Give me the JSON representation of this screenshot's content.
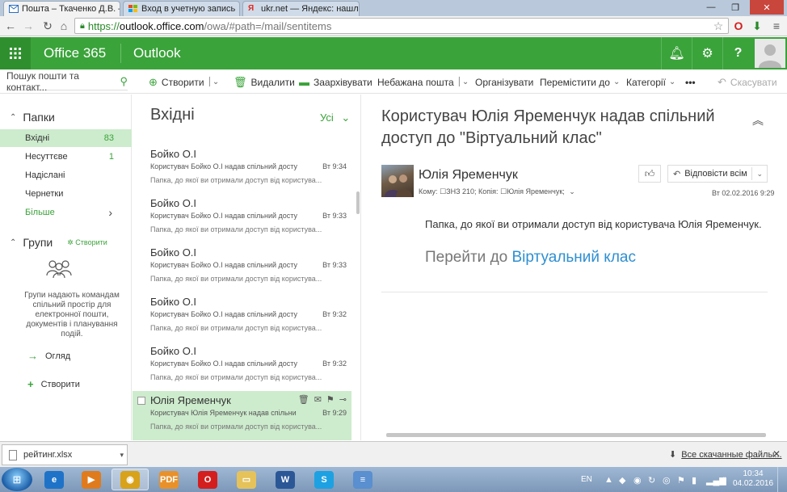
{
  "browser": {
    "tabs": [
      {
        "label": "Пошта – Ткаченко Д.В. – "
      },
      {
        "label": "Вход в учетную запись"
      },
      {
        "label": "ukr.net — Яндекс: нашло"
      }
    ],
    "url_scheme": "https://",
    "url_host": "outlook.office.com",
    "url_path": "/owa/#path=/mail/sentitems"
  },
  "suite": {
    "brand": "Office 365",
    "app": "Outlook",
    "accent": "#3aa33a"
  },
  "commands": {
    "search_placeholder": "Пошук пошти та контакт...",
    "new": "Створити",
    "delete": "Видалити",
    "archive": "Заархівувати",
    "junk": "Небажана пошта",
    "sweep": "Організувати",
    "move": "Перемістити до",
    "categories": "Категорії",
    "more": "•••",
    "undo": "Скасувати"
  },
  "folders": {
    "section": "Папки",
    "items": [
      {
        "label": "Вхідні",
        "count": "83"
      },
      {
        "label": "Несуттєве",
        "count": "1"
      },
      {
        "label": "Надіслані",
        "count": ""
      },
      {
        "label": "Чернетки",
        "count": ""
      }
    ],
    "more": "Більше"
  },
  "groups": {
    "section": "Групи",
    "create_small": "Створити",
    "description": "Групи надають командам спільний простір для електронної пошти, документів і планування подій.",
    "browse": "Огляд",
    "create": "Створити"
  },
  "list": {
    "title": "Вхідні",
    "filter": "Усі",
    "messages": [
      {
        "from": "Бойко О.І",
        "subject": "Користувач Бойко О.І надав спільний досту",
        "time": "Вт 9:34",
        "preview": "Папка, до якої ви отримали доступ від користува..."
      },
      {
        "from": "Бойко О.І",
        "subject": "Користувач Бойко О.І надав спільний досту",
        "time": "Вт 9:33",
        "preview": "Папка, до якої ви отримали доступ від користува..."
      },
      {
        "from": "Бойко О.І",
        "subject": "Користувач Бойко О.І надав спільний досту",
        "time": "Вт 9:33",
        "preview": "Папка, до якої ви отримали доступ від користува..."
      },
      {
        "from": "Бойко О.І",
        "subject": "Користувач Бойко О.І надав спільний досту",
        "time": "Вт 9:32",
        "preview": "Папка, до якої ви отримали доступ від користува..."
      },
      {
        "from": "Бойко О.І",
        "subject": "Користувач Бойко О.І надав спільний досту",
        "time": "Вт 9:32",
        "preview": "Папка, до якої ви отримали доступ від користува..."
      },
      {
        "from": "Юлія Яременчук",
        "subject": "Користувач Юлія Яременчук надав спільни",
        "time": "Вт 9:29",
        "preview": "Папка, до якої ви отримали доступ від користува..."
      }
    ]
  },
  "reading": {
    "subject": "Користувач Юлія Яременчук надав спільний доступ до \"Віртуальний клас\"",
    "sender": "Юлія Яременчук",
    "to_label": "Кому:",
    "to": "ЗНЗ 210;",
    "cc_label": "Копія:",
    "cc": "Юлія Яременчук;",
    "reply_all": "Відповісти всім",
    "date": "Вт 02.02.2016 9:29",
    "body": "Папка, до якої ви отримали доступ від користувача Юлія Яременчук.",
    "goto_prefix": "Перейти до ",
    "goto_link": "Віртуальний клас"
  },
  "downloads": {
    "file": "рейтинг.xlsx",
    "all": "Все скачанные файлы..."
  },
  "taskbar": {
    "lang": "EN",
    "time": "10:34",
    "date": "04.02.2016",
    "apps": [
      {
        "icon": "ie-icon",
        "color": "#1e73c8",
        "glyph": "e"
      },
      {
        "icon": "media-player-icon",
        "color": "#e07b1d",
        "glyph": "▶"
      },
      {
        "icon": "chrome-icon",
        "color": "#d8a21a",
        "glyph": "◉"
      },
      {
        "icon": "pdf-icon",
        "color": "#e8912a",
        "glyph": "PDF"
      },
      {
        "icon": "opera-icon",
        "color": "#d41e1e",
        "glyph": "O"
      },
      {
        "icon": "explorer-folder-icon",
        "color": "#e5c25a",
        "glyph": "▭"
      },
      {
        "icon": "word-icon",
        "color": "#2b5797",
        "glyph": "W"
      },
      {
        "icon": "skype-icon",
        "color": "#1da1e2",
        "glyph": "S"
      },
      {
        "icon": "file-manager-icon",
        "color": "#5a8fd0",
        "glyph": "≡"
      }
    ]
  }
}
